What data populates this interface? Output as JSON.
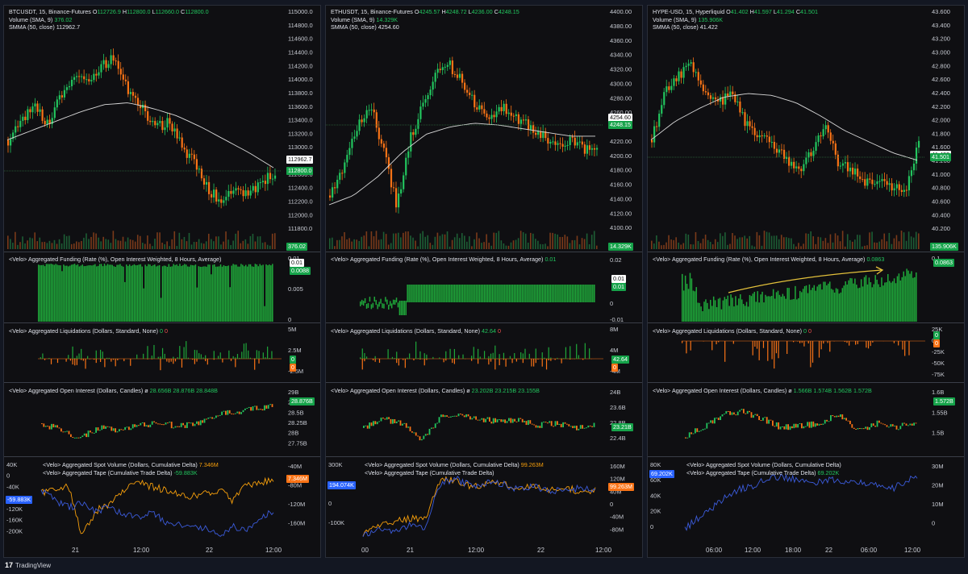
{
  "footer": {
    "brand": "TradingView",
    "logo_glyph": "17"
  },
  "charts": [
    {
      "symbol_line": "BTCUSDT, 15, Binance-Futures",
      "ohlc": {
        "o_label": "O",
        "o": "112726.9",
        "h_label": "H",
        "h": "112800.0",
        "l_label": "L",
        "l": "112660.0",
        "c_label": "C",
        "c": "112800.0"
      },
      "volume_label": "Volume (SMA, 9)",
      "volume_value": "376.02",
      "smma_label": "SMMA (50, close)",
      "smma_value": "112962.7",
      "price_axis": [
        "115000.0",
        "114800.0",
        "114600.0",
        "114400.0",
        "114200.0",
        "114000.0",
        "113800.0",
        "113600.0",
        "113400.0",
        "113200.0",
        "113000.0",
        "112800.0",
        "112600.0",
        "112400.0",
        "112200.0",
        "112000.0",
        "111800.0"
      ],
      "price_tags": {
        "smma": "112962.7",
        "last": "112800.0",
        "volume": "376.02"
      },
      "funding": {
        "legend": "<Velo> Aggregated Funding (Rate (%), Open Interest Weighted, 8 Hours, Average)",
        "value": "",
        "axis": [
          "0.01",
          "0.005",
          "0"
        ],
        "tags": [
          "0.01",
          "0.0088"
        ]
      },
      "liquidations": {
        "legend": "<Velo> Aggregated Liquidations (Dollars, Standard, None)",
        "v1": "0",
        "v2": "0",
        "axis": [
          "5M",
          "2.5M",
          "-2.5M"
        ],
        "tags": [
          "0",
          "0"
        ]
      },
      "oi": {
        "legend": "<Velo> Aggregated Open Interest (Dollars, Candles)",
        "sym": "ø",
        "vals": [
          "28.656B",
          "28.876B",
          "28.848B"
        ],
        "axis": [
          "29B",
          "28.75B",
          "28.5B",
          "28.25B",
          "28B",
          "27.75B"
        ],
        "tag": "28.876B"
      },
      "cvd": {
        "spot_legend": "<Velo> Aggregated Spot Volume (Dollars, Cumulative Delta)",
        "spot_val": "7.346M",
        "tape_legend": "<Velo> Aggregated Tape (Cumulative Trade Delta)",
        "tape_val": "-59.883K",
        "left_axis": [
          "40K",
          "0",
          "-40K",
          "-80K",
          "-120K",
          "-160K",
          "-200K"
        ],
        "right_axis": [
          "-40M",
          "-80M",
          "-120M",
          "-160M"
        ],
        "tag_left": "-59.883K",
        "tag_right": "7.346M"
      },
      "time_axis": [
        "21",
        "12:00",
        "22",
        "12:00"
      ]
    },
    {
      "symbol_line": "ETHUSDT, 15, Binance-Futures",
      "ohlc": {
        "o_label": "O",
        "o": "4245.57",
        "h_label": "H",
        "h": "4248.72",
        "l_label": "L",
        "l": "4236.00",
        "c_label": "C",
        "c": "4248.15"
      },
      "volume_label": "Volume (SMA, 9)",
      "volume_value": "14.329K",
      "smma_label": "SMMA (50, close)",
      "smma_value": "4254.60",
      "price_axis": [
        "4400.00",
        "4380.00",
        "4360.00",
        "4340.00",
        "4320.00",
        "4300.00",
        "4280.00",
        "4260.00",
        "4240.00",
        "4220.00",
        "4200.00",
        "4180.00",
        "4160.00",
        "4140.00",
        "4120.00",
        "4100.00"
      ],
      "price_tags": {
        "smma": "4254.60",
        "last": "4248.15",
        "volume": "14.329K"
      },
      "funding": {
        "legend": "<Velo> Aggregated Funding (Rate (%), Open Interest Weighted, 8 Hours, Average)",
        "value": "0.01",
        "axis": [
          "0.02",
          "0",
          "-0.01"
        ],
        "tags": [
          "0.01",
          "0.01"
        ]
      },
      "liquidations": {
        "legend": "<Velo> Aggregated Liquidations (Dollars, Standard, None)",
        "v1": "42.64",
        "v2": "0",
        "axis": [
          "8M",
          "4M",
          "-4M"
        ],
        "tags": [
          "42.64",
          "0"
        ]
      },
      "oi": {
        "legend": "<Velo> Aggregated Open Interest (Dollars, Candles)",
        "sym": "ø",
        "vals": [
          "23.202B",
          "23.215B",
          "23.155B"
        ],
        "axis": [
          "24B",
          "23.6B",
          "22.8B",
          "22.4B"
        ],
        "tag": "23.21B"
      },
      "cvd": {
        "spot_legend": "<Velo> Aggregated Spot Volume (Dollars, Cumulative Delta)",
        "spot_val": "99.263M",
        "tape_legend": "<Velo> Aggregated Tape (Cumulative Trade Delta)",
        "tape_val": "",
        "left_axis": [
          "300K",
          "100K",
          "0",
          "-100K"
        ],
        "right_axis": [
          "160M",
          "120M",
          "40M",
          "0",
          "-40M",
          "-80M"
        ],
        "tag_left": "194.074K",
        "tag_right": "99.263M"
      },
      "time_axis": [
        "00",
        "21",
        "12:00",
        "22",
        "12:00"
      ]
    },
    {
      "symbol_line": "HYPE-USD, 15, Hyperliquid",
      "ohlc": {
        "o_label": "O",
        "o": "41.402",
        "h_label": "H",
        "h": "41.597",
        "l_label": "L",
        "l": "41.294",
        "c_label": "C",
        "c": "41.501"
      },
      "volume_label": "Volume (SMA, 9)",
      "volume_value": "135.906K",
      "smma_label": "SMMA (50, close)",
      "smma_value": "41.422",
      "price_axis": [
        "43.600",
        "43.400",
        "43.200",
        "43.000",
        "42.800",
        "42.600",
        "42.400",
        "42.200",
        "42.000",
        "41.800",
        "41.600",
        "41.200",
        "41.000",
        "40.800",
        "40.600",
        "40.400",
        "40.200"
      ],
      "price_tags": {
        "smma": "41.422",
        "last": "41.501",
        "volume": "135.906K"
      },
      "funding": {
        "legend": "<Velo> Aggregated Funding (Rate (%), Open Interest Weighted, 8 Hours, Average)",
        "value": "0.0863",
        "axis": [
          "0.1"
        ],
        "tags": [
          "0.0863"
        ]
      },
      "liquidations": {
        "legend": "<Velo> Aggregated Liquidations (Dollars, Standard, None)",
        "v1": "0",
        "v2": "0",
        "axis": [
          "25K",
          "0",
          "-25K",
          "-50K",
          "-75K"
        ],
        "tags": [
          "0",
          "0"
        ]
      },
      "oi": {
        "legend": "<Velo> Aggregated Open Interest (Dollars, Candles)",
        "sym": "ø",
        "vals": [
          "1.566B",
          "1.574B",
          "1.562B",
          "1.572B"
        ],
        "axis": [
          "1.6B",
          "1.55B",
          "1.5B"
        ],
        "tag": "1.572B"
      },
      "cvd": {
        "spot_legend": "<Velo> Aggregated Spot Volume (Dollars, Cumulative Delta)",
        "spot_val": "",
        "tape_legend": "<Velo> Aggregated Tape (Cumulative Trade Delta)",
        "tape_val": "69.202K",
        "left_axis": [
          "80K",
          "60K",
          "40K",
          "20K",
          "0"
        ],
        "right_axis": [
          "30M",
          "20M",
          "10M",
          "0"
        ],
        "tag_left": "69.202K",
        "tag_right": ""
      },
      "time_axis": [
        "06:00",
        "12:00",
        "18:00",
        "22",
        "06:00",
        "12:00"
      ]
    }
  ],
  "colors": {
    "up": "#22c55e",
    "down": "#f97316",
    "smma": "#d9d9d9",
    "tape": "#3b5bdb",
    "spot": "#f59e0b",
    "annotation": "#e3c13b"
  }
}
